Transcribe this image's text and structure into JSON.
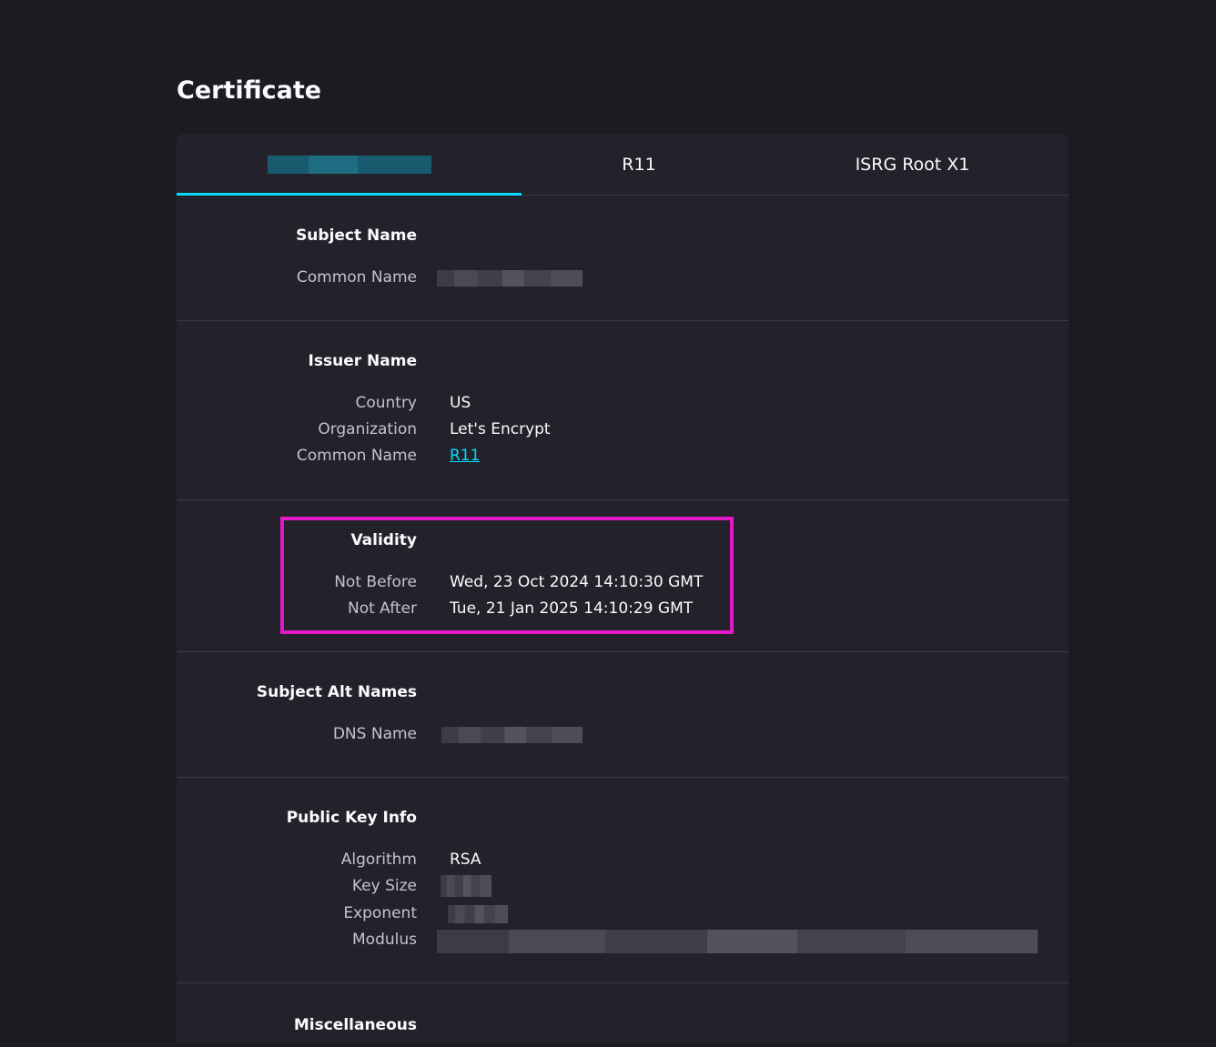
{
  "page": {
    "title": "Certificate"
  },
  "tabs": [
    {
      "label": "",
      "redacted": true
    },
    {
      "label": "R11"
    },
    {
      "label": "ISRG Root X1"
    }
  ],
  "subject_name": {
    "heading": "Subject Name",
    "common_name_label": "Common Name"
  },
  "issuer_name": {
    "heading": "Issuer Name",
    "country_label": "Country",
    "country_value": "US",
    "organization_label": "Organization",
    "organization_value": "Let's Encrypt",
    "common_name_label": "Common Name",
    "common_name_value": "R11"
  },
  "validity": {
    "heading": "Validity",
    "not_before_label": "Not Before",
    "not_before_value": "Wed, 23 Oct 2024 14:10:30 GMT",
    "not_after_label": "Not After",
    "not_after_value": "Tue, 21 Jan 2025 14:10:29 GMT"
  },
  "subject_alt_names": {
    "heading": "Subject Alt Names",
    "dns_label": "DNS Name"
  },
  "public_key_info": {
    "heading": "Public Key Info",
    "algorithm_label": "Algorithm",
    "algorithm_value": "RSA",
    "key_size_label": "Key Size",
    "exponent_label": "Exponent",
    "modulus_label": "Modulus"
  },
  "misc": {
    "heading": "Miscellaneous"
  },
  "colors": {
    "accent": "#00ddff",
    "highlight": "#e319c8",
    "background": "#1c1b22",
    "card": "#23222b"
  }
}
